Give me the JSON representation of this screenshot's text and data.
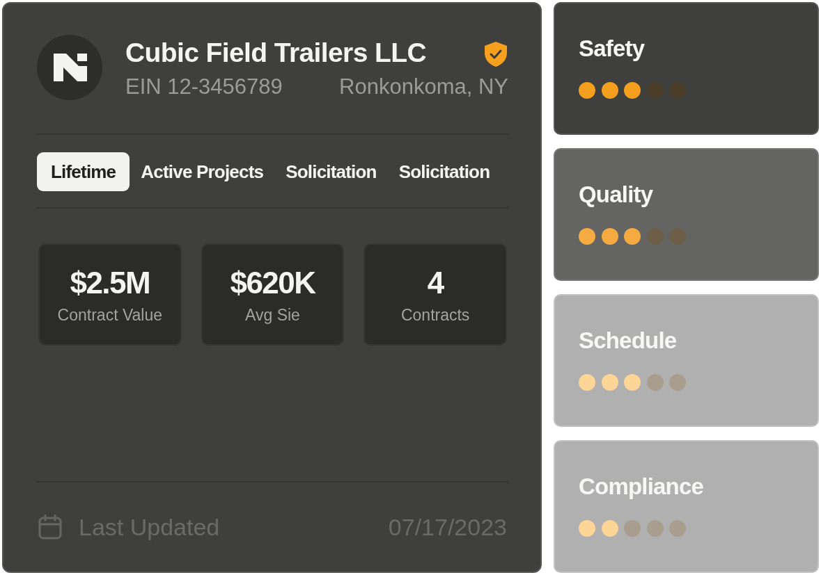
{
  "company": {
    "name": "Cubic Field Trailers LLC",
    "verified": true,
    "ein": "EIN 12-3456789",
    "location": "Ronkonkoma, NY"
  },
  "tabs": [
    {
      "label": "Lifetime",
      "selected": true
    },
    {
      "label": "Active Projects",
      "selected": false
    },
    {
      "label": "Solicitation",
      "selected": false
    },
    {
      "label": "Solicitation",
      "selected": false
    }
  ],
  "stats": [
    {
      "value": "$2.5M",
      "label": "Contract Value"
    },
    {
      "value": "$620K",
      "label": "Avg Sie"
    },
    {
      "value": "4",
      "label": "Contracts"
    }
  ],
  "footer": {
    "label": "Last Updated",
    "date": "07/17/2023"
  },
  "scores": [
    {
      "label": "Safety",
      "kind": "solid",
      "stars": 3
    },
    {
      "label": "Quality",
      "kind": "dim",
      "stars": 3
    },
    {
      "label": "Schedule",
      "kind": "faded",
      "stars": 3
    },
    {
      "label": "Compliance",
      "kind": "faded",
      "stars": 2
    }
  ]
}
